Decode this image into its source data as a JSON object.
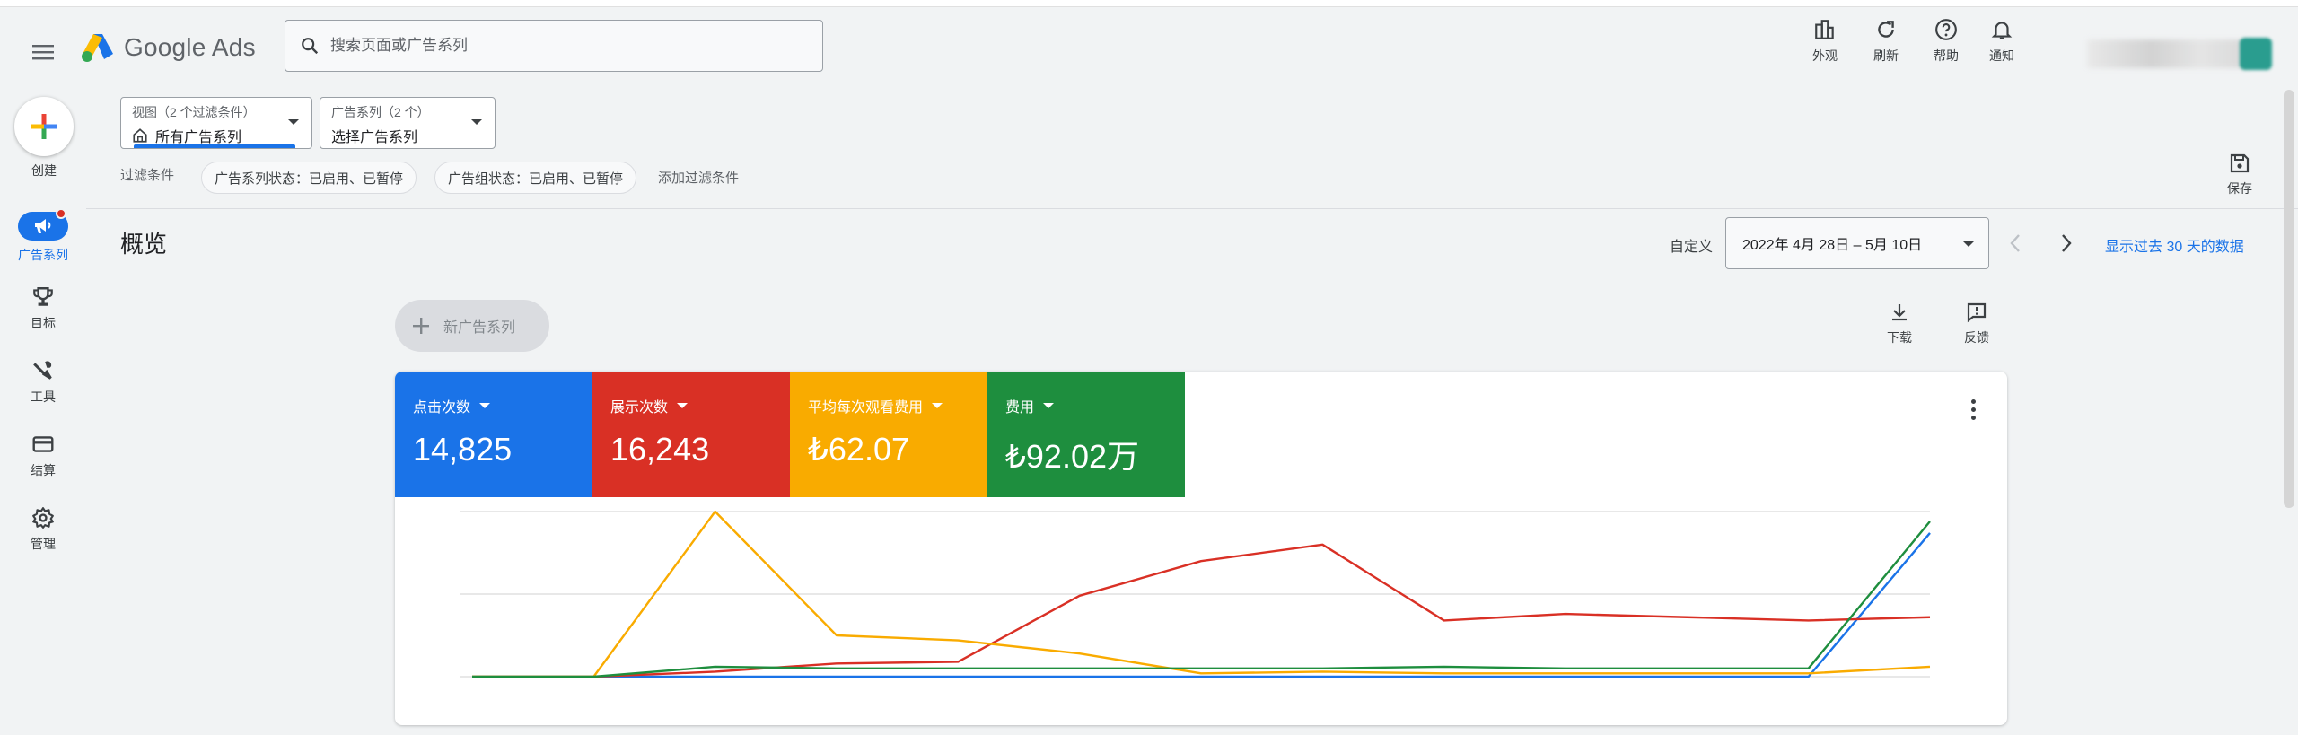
{
  "topbar": {
    "logo_text": "Google Ads",
    "search_placeholder": "搜索页面或广告系列",
    "actions": [
      {
        "label": "外观",
        "icon": "appearance-icon"
      },
      {
        "label": "刷新",
        "icon": "refresh-icon"
      },
      {
        "label": "帮助",
        "icon": "help-icon"
      },
      {
        "label": "通知",
        "icon": "bell-icon"
      }
    ]
  },
  "sidebar": {
    "create_label": "创建",
    "items": [
      {
        "label": "广告系列",
        "icon": "campaign-icon",
        "active": true
      },
      {
        "label": "目标",
        "icon": "trophy-icon"
      },
      {
        "label": "工具",
        "icon": "tools-icon"
      },
      {
        "label": "结算",
        "icon": "billing-icon"
      },
      {
        "label": "管理",
        "icon": "gear-icon"
      }
    ]
  },
  "filters": {
    "view_small": "视图（2 个过滤条件）",
    "view_main": "所有广告系列",
    "campaign_small": "广告系列（2 个）",
    "campaign_main": "选择广告系列",
    "filter_label": "过滤条件",
    "chips": [
      "广告系列状态：已启用、已暂停",
      "广告组状态：已启用、已暂停"
    ],
    "add_filter": "添加过滤条件",
    "save_label": "保存"
  },
  "overview": {
    "title": "概览",
    "custom_label": "自定义",
    "date_range": "2022年 4月 28日 – 5月 10日",
    "last30": "显示过去 30 天的数据",
    "new_campaign": "新广告系列",
    "download": "下载",
    "feedback": "反馈"
  },
  "metrics": [
    {
      "label": "点击次数",
      "value": "14,825",
      "color": "#1a73e8"
    },
    {
      "label": "展示次数",
      "value": "16,243",
      "color": "#d93025"
    },
    {
      "label": "平均每次观看费用",
      "value": "₺62.07",
      "color": "#f9ab00"
    },
    {
      "label": "费用",
      "value": "₺92.02万",
      "color": "#1e8e3e"
    }
  ],
  "chart_data": {
    "type": "line",
    "x": [
      1,
      2,
      3,
      4,
      5,
      6,
      7,
      8,
      9,
      10,
      11,
      12,
      13
    ],
    "ylim": [
      0,
      100
    ],
    "grid": true,
    "series": [
      {
        "color": "#1a73e8",
        "values": [
          0,
          0,
          0,
          0,
          0,
          0,
          0,
          0,
          0,
          0,
          0,
          0,
          87
        ]
      },
      {
        "color": "#d93025",
        "values": [
          0,
          0,
          3,
          8,
          9,
          49,
          70,
          80,
          34,
          38,
          36,
          34,
          36
        ]
      },
      {
        "color": "#f9ab00",
        "values": [
          0,
          0,
          100,
          25,
          22,
          14,
          2,
          3,
          2,
          2,
          2,
          2,
          6
        ]
      },
      {
        "color": "#1e8e3e",
        "values": [
          0,
          0,
          6,
          5,
          5,
          5,
          5,
          5,
          6,
          5,
          5,
          5,
          94
        ]
      }
    ]
  }
}
